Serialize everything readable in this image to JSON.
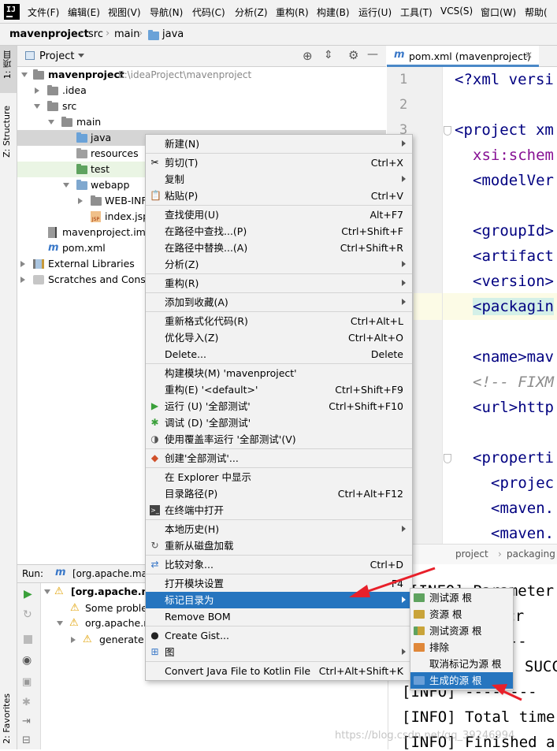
{
  "menubar": {
    "items": [
      "文件(F)",
      "编辑(E)",
      "视图(V)",
      "导航(N)",
      "代码(C)",
      "分析(Z)",
      "重构(R)",
      "构建(B)",
      "运行(U)",
      "工具(T)",
      "VCS(S)",
      "窗口(W)",
      "帮助("
    ]
  },
  "breadcrumb": [
    "mavenproject",
    "src",
    "main",
    "java"
  ],
  "left_strip": {
    "project_tab": "1: 项目",
    "structure_tab": "Z: Structure",
    "favorites_tab": "2: Favorites"
  },
  "project_panel": {
    "title": "Project",
    "tree": [
      {
        "label": "mavenproject",
        "path": "E:\\ideaProject\\mavenproject"
      },
      {
        "label": ".idea"
      },
      {
        "label": "src"
      },
      {
        "label": "main"
      },
      {
        "label": "java"
      },
      {
        "label": "resources"
      },
      {
        "label": "test"
      },
      {
        "label": "webapp"
      },
      {
        "label": "WEB-INF"
      },
      {
        "label": "index.jsp"
      },
      {
        "label": "mavenproject.iml"
      },
      {
        "label": "pom.xml"
      },
      {
        "label": "External Libraries"
      },
      {
        "label": "Scratches and Conso"
      }
    ]
  },
  "editor": {
    "tab_label": "pom.xml (mavenproject)",
    "line_numbers": [
      "1",
      "2",
      "3"
    ],
    "lines": [
      {
        "text": "<?xml versi"
      },
      {
        "text": "<project xm"
      },
      {
        "text": "xsi:schem"
      },
      {
        "text": "<modelVer"
      },
      {
        "text": "<groupId>"
      },
      {
        "text": "<artifact"
      },
      {
        "text": "<version>"
      },
      {
        "text": "<packagin"
      },
      {
        "text": "<name>mav"
      },
      {
        "text": "<!-- FIXM"
      },
      {
        "text": "<url>http"
      },
      {
        "text": "<properti"
      },
      {
        "text": "<projec"
      },
      {
        "text": "<maven."
      },
      {
        "text": "<maven."
      }
    ],
    "breadcrumb": [
      "project",
      "packaging"
    ]
  },
  "run_panel": {
    "label": "Run:",
    "tab": "[org.apache.ma",
    "tree": [
      {
        "label": "[org.apache.ma"
      },
      {
        "label": "Some proble"
      },
      {
        "label": "org.apache.m"
      },
      {
        "label": "generate"
      }
    ],
    "console": [
      "[INFO] Parameter:",
      "ct cr",
      "------",
      "SUCC",
      "[INFO] --------",
      "[INFO] Total time",
      "[INFO] Finished a"
    ],
    "watermark": "https://blog.csdn.net/qq_39246994"
  },
  "context_menu": {
    "items": [
      {
        "label": "新建(N)",
        "shortcut": "",
        "submenu": true
      },
      {
        "label": "剪切(T)",
        "shortcut": "Ctrl+X",
        "icon": "cut-icon"
      },
      {
        "label": "复制",
        "shortcut": "",
        "submenu": true
      },
      {
        "label": "粘贴(P)",
        "shortcut": "Ctrl+V",
        "icon": "paste-icon"
      },
      {
        "label": "查找使用(U)",
        "shortcut": "Alt+F7"
      },
      {
        "label": "在路径中查找...(P)",
        "shortcut": "Ctrl+Shift+F"
      },
      {
        "label": "在路径中替换...(A)",
        "shortcut": "Ctrl+Shift+R"
      },
      {
        "label": "分析(Z)",
        "shortcut": "",
        "submenu": true
      },
      {
        "label": "重构(R)",
        "shortcut": "",
        "submenu": true
      },
      {
        "label": "添加到收藏(A)",
        "shortcut": "",
        "submenu": true
      },
      {
        "label": "重新格式化代码(R)",
        "shortcut": "Ctrl+Alt+L"
      },
      {
        "label": "优化导入(Z)",
        "shortcut": "Ctrl+Alt+O"
      },
      {
        "label": "Delete...",
        "shortcut": "Delete"
      },
      {
        "label": "构建模块(M) 'mavenproject'",
        "shortcut": ""
      },
      {
        "label": "重构(E) '<default>'",
        "shortcut": "Ctrl+Shift+F9"
      },
      {
        "label": "运行 (U) '全部测试'",
        "shortcut": "Ctrl+Shift+F10",
        "icon": "run-icon"
      },
      {
        "label": "调试 (D) '全部测试'",
        "shortcut": "",
        "icon": "debug-icon"
      },
      {
        "label": "使用覆盖率运行 '全部测试'(V)",
        "shortcut": "",
        "icon": "coverage-icon"
      },
      {
        "label": "创建'全部测试'...",
        "shortcut": "",
        "icon": "create-config-icon"
      },
      {
        "label": "在 Explorer 中显示",
        "shortcut": ""
      },
      {
        "label": "目录路径(P)",
        "shortcut": "Ctrl+Alt+F12"
      },
      {
        "label": "在终端中打开",
        "shortcut": "",
        "icon": "terminal-icon"
      },
      {
        "label": "本地历史(H)",
        "shortcut": "",
        "submenu": true
      },
      {
        "label": "重新从磁盘加载",
        "shortcut": "",
        "icon": "reload-icon"
      },
      {
        "label": "比较对象...",
        "shortcut": "Ctrl+D",
        "icon": "compare-icon"
      },
      {
        "label": "打开模块设置",
        "shortcut": "F4"
      },
      {
        "label": "标记目录为",
        "shortcut": "",
        "submenu": true,
        "selected": true
      },
      {
        "label": "Remove BOM",
        "shortcut": ""
      },
      {
        "label": "Create Gist...",
        "shortcut": "",
        "icon": "github-icon"
      },
      {
        "label": "图",
        "shortcut": "",
        "submenu": true,
        "icon": "diagram-icon"
      },
      {
        "label": "Convert Java File to Kotlin File",
        "shortcut": "Ctrl+Alt+Shift+K"
      }
    ]
  },
  "submenu": {
    "items": [
      {
        "label": "测试源 根",
        "color": "#5fa35f"
      },
      {
        "label": "资源 根",
        "color": "#c9a43a"
      },
      {
        "label": "测试资源 根",
        "color": "#c9a43a"
      },
      {
        "label": "排除",
        "color": "#e0883a"
      },
      {
        "label": "取消标记为源 根",
        "color": ""
      },
      {
        "label": "生成的源 根",
        "color": "#6a9fd8",
        "selected": true
      }
    ]
  },
  "colors": {
    "selection": "#2675bf",
    "arrow": "#e8202a",
    "keyword": "#000080",
    "comment": "#8c8c8c"
  }
}
